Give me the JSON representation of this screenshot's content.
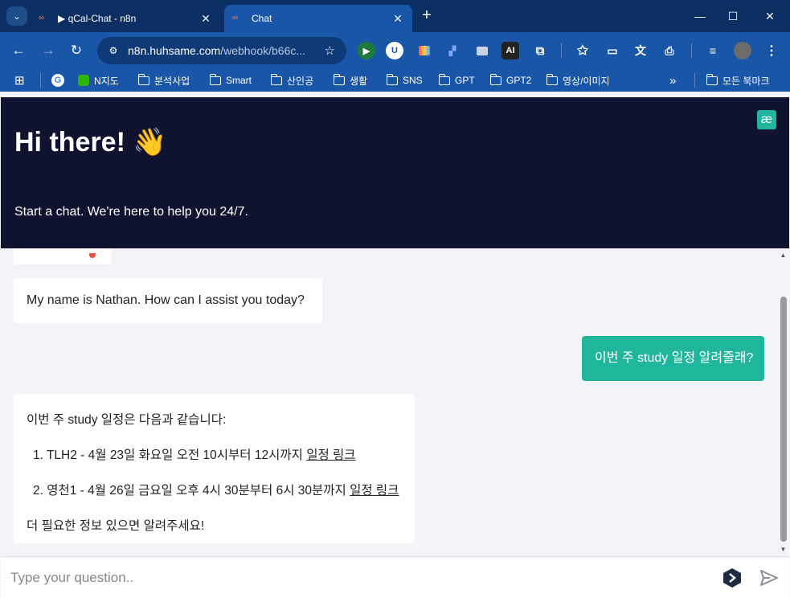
{
  "browser": {
    "tabs": [
      {
        "title": "▶ qCal-Chat - n8n",
        "active": false
      },
      {
        "title": "Chat",
        "active": true
      }
    ],
    "url_host": "n8n.huhsame.com",
    "url_path": "/webhook/b66c...",
    "extensions": [
      "AI"
    ],
    "bookmarks": [
      "N지도",
      "분석사업",
      "Smart",
      "산인공",
      "생활",
      "SNS",
      "GPT",
      "GPT2",
      "영상/이미지"
    ],
    "bookmarks_overflow": "»",
    "all_bookmarks": "모든 북마크"
  },
  "chat": {
    "title": "Hi there! 👋",
    "subtitle": "Start a chat. We're here to help you 24/7.",
    "messages": {
      "bot1": "My name is Nathan. How can I assist you today?",
      "user1": "이번 주 study 일정 알려줄래?",
      "bot2": {
        "intro": "이번 주 study 일정은 다음과 같습니다:",
        "items": [
          {
            "text": "1. TLH2 - 4월 23일 화요일 오전 10시부터 12시까지 ",
            "link": "일정 링크"
          },
          {
            "text": "2. 영천1 - 4월 26일 금요일 오후 4시 30분부터 6시 30분까지 ",
            "link": "일정 링크"
          }
        ],
        "outro": "더 필요한 정보 있으면 알려주세요!"
      }
    },
    "input_placeholder": "Type your question..",
    "colors": {
      "header_bg": "#101330",
      "accent": "#20b69e",
      "page_bg": "#f2f4f8"
    }
  }
}
